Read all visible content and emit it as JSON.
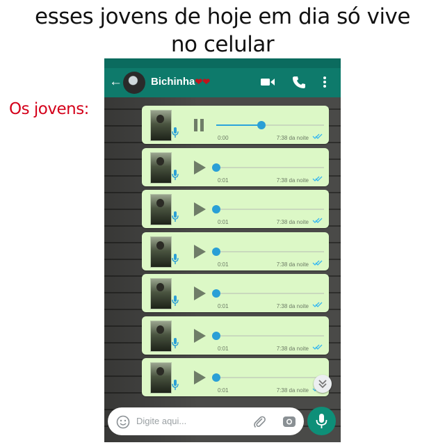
{
  "meme": {
    "title_line1": "esses jovens de hoje em dia só vive",
    "title_line2": "no celular",
    "side_caption": "Os jovens:"
  },
  "chat": {
    "contact_name": "Bichinha",
    "hearts": "❤❤",
    "header_color": "#0e7a6b"
  },
  "messages": [
    {
      "duration": "0:00",
      "time": "7:38 da noite",
      "state": "playing",
      "progress": 0.42
    },
    {
      "duration": "0:01",
      "time": "7:38 da noite",
      "state": "paused",
      "progress": 0
    },
    {
      "duration": "0:01",
      "time": "7:38 da noite",
      "state": "paused",
      "progress": 0
    },
    {
      "duration": "0:01",
      "time": "7:38 da noite",
      "state": "paused",
      "progress": 0
    },
    {
      "duration": "0:01",
      "time": "7:38 da noite",
      "state": "paused",
      "progress": 0
    },
    {
      "duration": "0:01",
      "time": "7:38 da noite",
      "state": "paused",
      "progress": 0
    },
    {
      "duration": "0:01",
      "time": "7:38 da noite",
      "state": "paused",
      "progress": 0
    }
  ],
  "composer": {
    "placeholder": "Digite aqui..."
  },
  "icons": {
    "back": "arrow-left-icon",
    "video": "video-camera-icon",
    "call": "phone-icon",
    "menu": "more-vert-icon",
    "emoji": "emoji-icon",
    "attach": "paperclip-icon",
    "camera": "camera-icon",
    "send": "microphone-icon",
    "scroll": "double-chevron-down-icon"
  },
  "colors": {
    "bubble": "#dcf8c6",
    "accent": "#2a9fd6",
    "caption_red": "#d4001a",
    "read_ticks": "#34b7f1"
  }
}
